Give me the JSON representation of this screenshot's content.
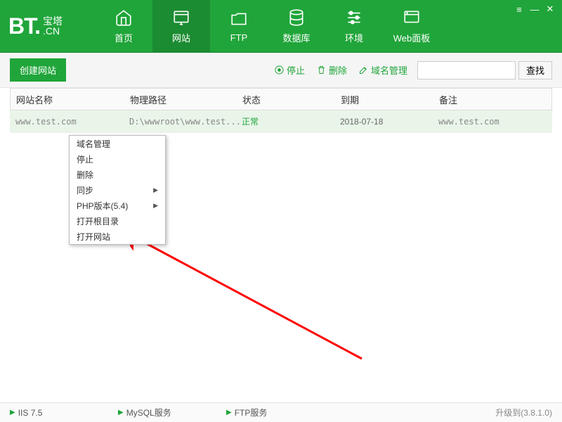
{
  "logo": {
    "bt": "BT.",
    "cn1": "宝塔",
    "cn2": ".CN"
  },
  "nav": [
    {
      "label": "首页"
    },
    {
      "label": "网站"
    },
    {
      "label": "FTP"
    },
    {
      "label": "数据库"
    },
    {
      "label": "环境"
    },
    {
      "label": "Web面板"
    }
  ],
  "toolbar": {
    "create": "创建网站",
    "stop": "停止",
    "delete": "删除",
    "domain": "域名管理",
    "search_btn": "查找"
  },
  "table": {
    "cols": [
      "网站名称",
      "物理路径",
      "状态",
      "到期",
      "备注"
    ],
    "row": {
      "name": "www.test.com",
      "path": "D:\\wwwroot\\www.test...",
      "status": "正常",
      "expiry": "2018-07-18",
      "note": "www.test.com"
    }
  },
  "context": [
    {
      "label": "域名管理",
      "sub": false
    },
    {
      "label": "停止",
      "sub": false
    },
    {
      "label": "删除",
      "sub": false
    },
    {
      "label": "同步",
      "sub": true
    },
    {
      "label": "PHP版本(5.4)",
      "sub": true
    },
    {
      "label": "打开根目录",
      "sub": false
    },
    {
      "label": "打开网站",
      "sub": false
    }
  ],
  "status": {
    "items": [
      "IIS 7.5",
      "MySQL服务",
      "FTP服务"
    ],
    "version": "升级到(3.8.1.0)"
  }
}
